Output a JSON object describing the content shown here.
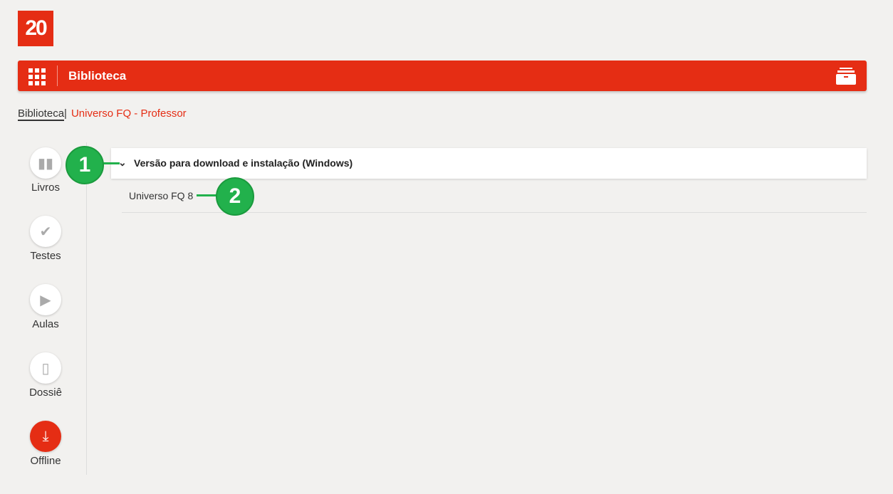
{
  "logo": {
    "text": "20"
  },
  "header": {
    "title": "Biblioteca",
    "brand_color": "#e52d14"
  },
  "breadcrumb": {
    "items": [
      "Biblioteca",
      "Universo FQ - Professor"
    ]
  },
  "sidebar": {
    "items": [
      {
        "label": "Livros",
        "icon": "book-icon"
      },
      {
        "label": "Testes",
        "icon": "check-icon"
      },
      {
        "label": "Aulas",
        "icon": "play-icon"
      },
      {
        "label": "Dossiê",
        "icon": "tablet-icon"
      },
      {
        "label": "Offline",
        "icon": "download-icon",
        "active": true
      }
    ]
  },
  "main": {
    "section_title": "Versão para download e instalação (Windows)",
    "items": [
      "Universo FQ 8"
    ]
  },
  "annotations": [
    "1",
    "2"
  ]
}
